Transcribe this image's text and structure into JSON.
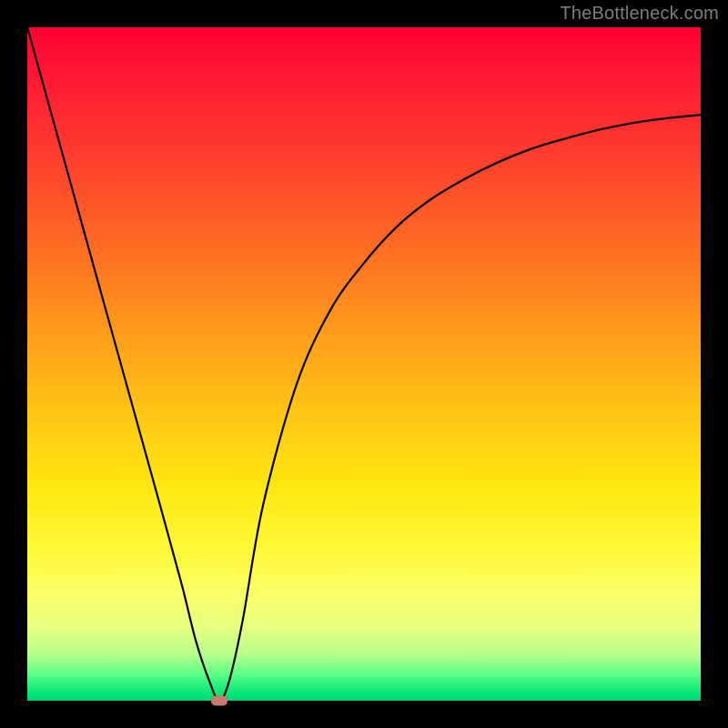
{
  "watermark": "TheBottleneck.com",
  "chart_data": {
    "type": "line",
    "title": "",
    "xlabel": "",
    "ylabel": "",
    "xlim": [
      0,
      100
    ],
    "ylim": [
      0,
      100
    ],
    "grid": false,
    "legend": false,
    "series": [
      {
        "name": "curve",
        "x": [
          0,
          5,
          10,
          15,
          20,
          23,
          25,
          27,
          28.5,
          30,
          32,
          35,
          40,
          45,
          50,
          55,
          60,
          65,
          70,
          75,
          80,
          85,
          90,
          95,
          100
        ],
        "y": [
          100,
          82,
          64,
          46,
          28,
          17,
          9,
          3,
          0,
          3,
          12,
          29,
          47,
          58,
          65,
          70.5,
          74.5,
          77.5,
          80,
          82,
          83.5,
          84.8,
          85.8,
          86.5,
          87
        ]
      }
    ],
    "marker": {
      "x": 28.5,
      "y": 0,
      "color": "#c97a6e"
    },
    "background_gradient_stops": [
      {
        "pos": 0,
        "color": "#ff0033"
      },
      {
        "pos": 50,
        "color": "#ffba14"
      },
      {
        "pos": 80,
        "color": "#fff833"
      },
      {
        "pos": 95,
        "color": "#7fff80"
      },
      {
        "pos": 100,
        "color": "#00d276"
      }
    ]
  }
}
